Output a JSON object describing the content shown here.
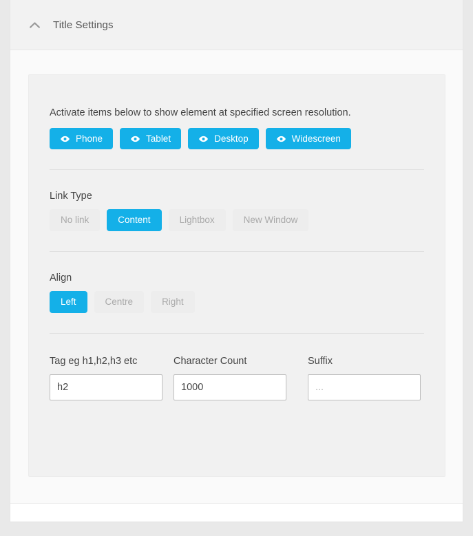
{
  "header": {
    "title": "Title Settings",
    "collapse_icon": "chevron-up-icon"
  },
  "visibility": {
    "lead_text": "Activate items below to show element at specified screen resolution.",
    "icon": "eye-icon",
    "buttons": [
      {
        "label": "Phone",
        "active": true
      },
      {
        "label": "Tablet",
        "active": true
      },
      {
        "label": "Desktop",
        "active": true
      },
      {
        "label": "Widescreen",
        "active": true
      }
    ]
  },
  "link_type": {
    "label": "Link Type",
    "options": [
      {
        "label": "No link",
        "active": false
      },
      {
        "label": "Content",
        "active": true
      },
      {
        "label": "Lightbox",
        "active": false
      },
      {
        "label": "New Window",
        "active": false
      }
    ]
  },
  "align": {
    "label": "Align",
    "options": [
      {
        "label": "Left",
        "active": true
      },
      {
        "label": "Centre",
        "active": false
      },
      {
        "label": "Right",
        "active": false
      }
    ]
  },
  "fields": {
    "tag": {
      "label": "Tag eg h1,h2,h3 etc",
      "value": "h2",
      "placeholder": ""
    },
    "character_count": {
      "label": "Character Count",
      "value": "1000",
      "placeholder": ""
    },
    "suffix": {
      "label": "Suffix",
      "value": "",
      "placeholder": "..."
    }
  },
  "colors": {
    "accent": "#14b0e8",
    "inactive_bg": "#ededed",
    "inactive_text": "#a9a9a9",
    "panel_bg": "#f1f1f1",
    "body_bg": "#fafafa",
    "header_bg": "#f2f2f2"
  }
}
